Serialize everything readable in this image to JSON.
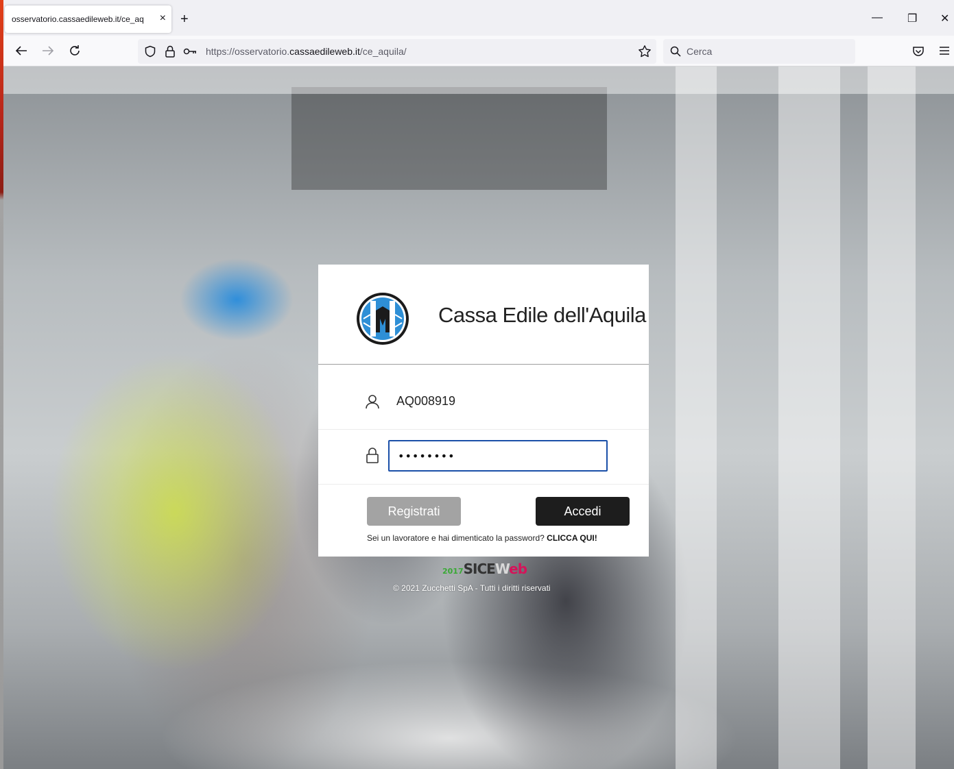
{
  "browser": {
    "tab_title": "osservatorio.cassaedileweb.it/ce_aq",
    "tab_close": "×",
    "new_tab": "+",
    "url_prefix": "https://osservatorio.",
    "url_domain": "cassaedileweb.it",
    "url_path": "/ce_aquila/",
    "search_placeholder": "Cerca",
    "minimize": "—",
    "restore": "❐",
    "close": "✕"
  },
  "login": {
    "org_name": "Cassa Edile dell'Aquila",
    "username": "AQ008919",
    "password_mask": "••••••••",
    "register_label": "Registrati",
    "login_label": "Accedi",
    "forgot_text": "Sei un lavoratore e hai dimenticato la password? ",
    "forgot_link": "CLICCA QUI!"
  },
  "footer": {
    "brand_year": "2017",
    "brand_sice": "SICE",
    "brand_w": "W",
    "brand_eb": "eb",
    "copyright": "© 2021 Zucchetti SpA - Tutti i diritti riservati"
  },
  "colors": {
    "accent_border": "#1a4fa8",
    "register_bg": "#a3a3a3",
    "login_bg": "#1d1d1d",
    "brand_magenta": "#d4145a",
    "brand_green": "#39a935"
  }
}
